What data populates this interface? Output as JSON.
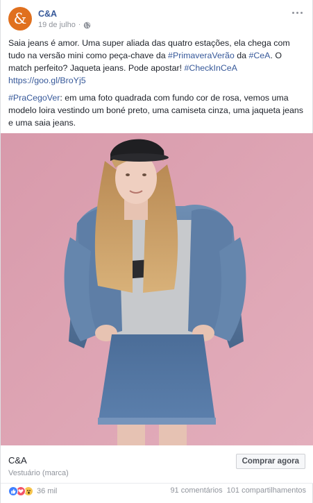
{
  "post": {
    "page_name": "C&A",
    "date": "19 de julho",
    "date_separator": "·",
    "paragraph1": {
      "t1": "Saia jeans é amor. Uma super aliada das quatro estações, ela chega com tudo na versão mini como peça-chave da ",
      "tag1": "#PrimaveraVerão",
      "t2": " da ",
      "tag2": "#CeA",
      "t3": ". O match perfeito? Jaqueta jeans. Pode apostar! ",
      "tag3": "#CheckInCeA"
    },
    "link": "https://goo.gl/BroYj5",
    "paragraph3": {
      "tag": "#PraCegoVer",
      "text": ": em uma foto quadrada com fundo cor de rosa, vemos uma modelo loira vestindo um boné preto, uma camiseta cinza, uma jaqueta jeans e uma saia jeans."
    }
  },
  "cta": {
    "title": "C&A",
    "subtitle": "Vestuário (marca)",
    "button": "Comprar agora"
  },
  "footer": {
    "reaction_count": "36 mil",
    "comments": "91 comentários",
    "shares": "101 compartilhamentos"
  },
  "colors": {
    "brand_orange": "#e0701e",
    "link_blue": "#365899",
    "photo_background_pink": "#dca1b1"
  },
  "icons": [
    "ca-logo-icon",
    "globe-icon",
    "more-options-icon",
    "like-reaction-icon",
    "love-reaction-icon",
    "wow-reaction-icon"
  ]
}
